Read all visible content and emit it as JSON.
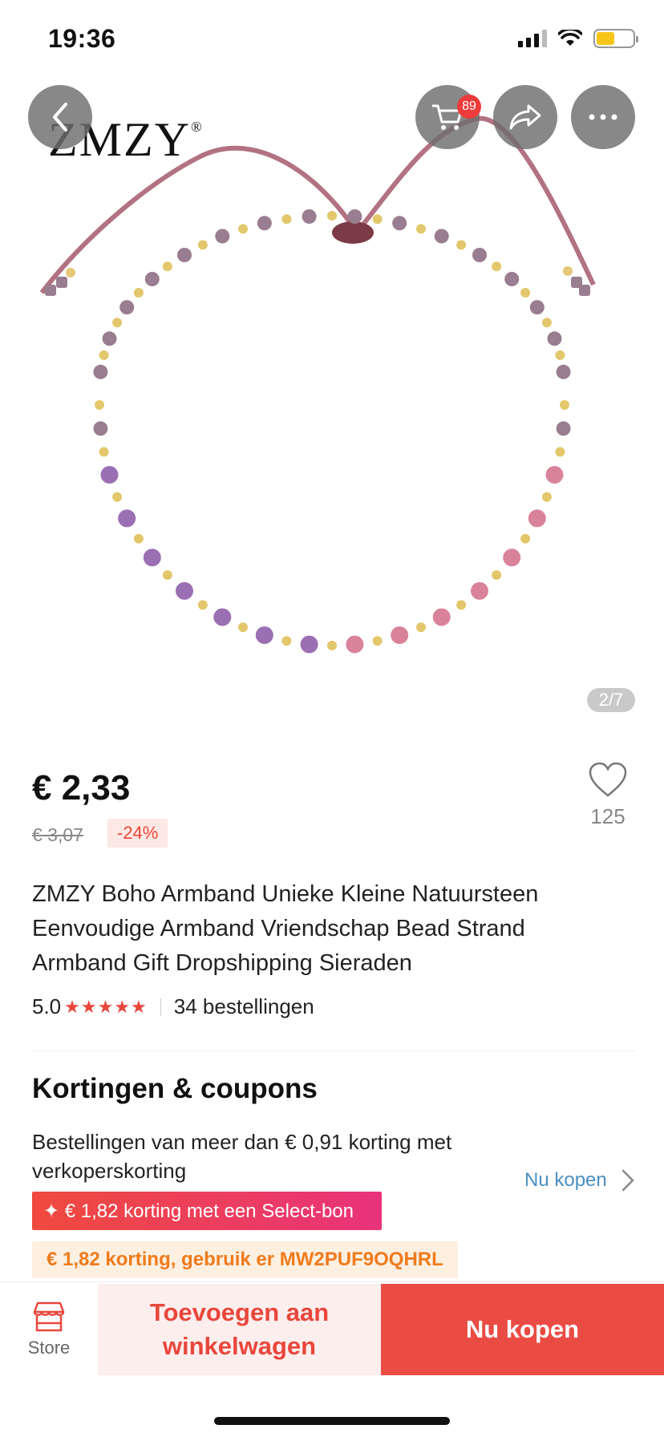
{
  "status_bar": {
    "time": "19:36"
  },
  "gallery": {
    "brand_logo": "ZMZY",
    "brand_mark": "®",
    "cart_badge": "89",
    "counter": "2/7"
  },
  "product": {
    "price": "€ 2,33",
    "old_price": "€ 3,07",
    "discount": "-24%",
    "wishlist_count": "125",
    "title": "ZMZY Boho Armband Unieke Kleine Natuursteen Eenvoudige Armband Vriendschap Bead Strand Armband Gift Dropshipping Sieraden",
    "rating": "5.0",
    "stars": "★★★★★",
    "orders": "34 bestellingen"
  },
  "coupons": {
    "heading": "Kortingen & coupons",
    "description": "Bestellingen van meer dan € 0,91 korting met verkoperskorting",
    "buy_link": "Nu kopen",
    "select_coupon": "✦ € 1,82 korting met een Select-bon",
    "code_coupon": "€ 1,82 korting, gebruik er MW2PUF9OQHRL"
  },
  "bottom_bar": {
    "store_label": "Store",
    "add_to_cart": "Toevoegen aan winkelwagen",
    "buy_now": "Nu kopen"
  },
  "colors": {
    "accent": "#ea4c44",
    "link": "#4a90c2",
    "coupon_orange": "#f07a1c"
  }
}
